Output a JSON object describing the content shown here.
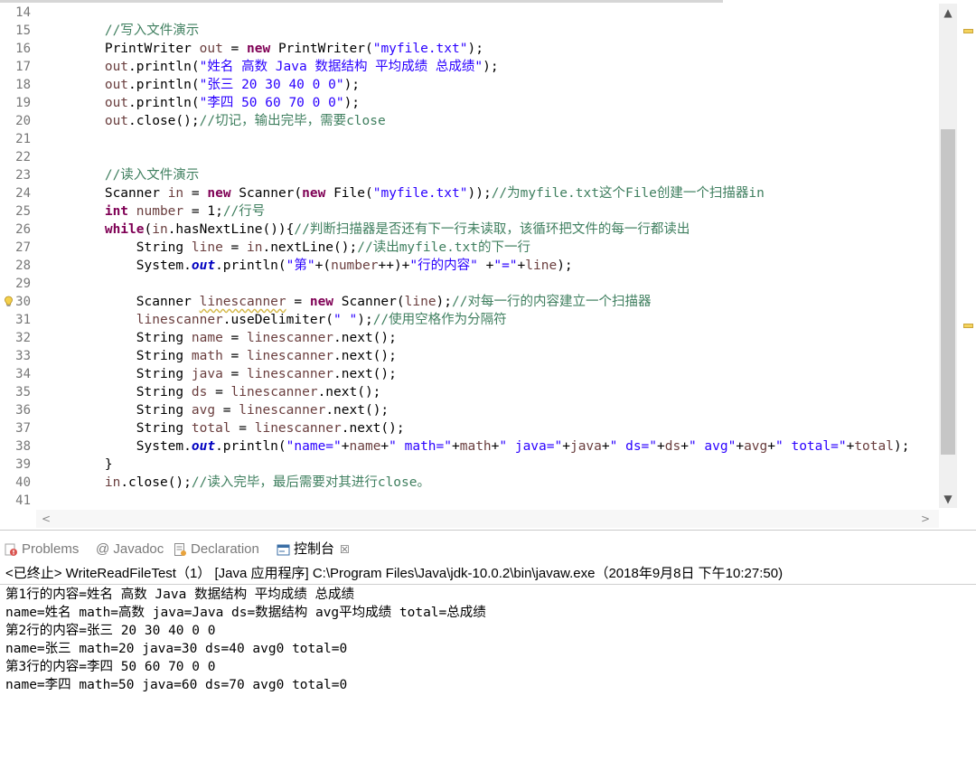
{
  "editor": {
    "line_numbers": [
      "14",
      "15",
      "16",
      "17",
      "18",
      "19",
      "20",
      "21",
      "22",
      "23",
      "24",
      "25",
      "26",
      "27",
      "28",
      "29",
      "30",
      "31",
      "32",
      "33",
      "34",
      "35",
      "36",
      "37",
      "38",
      "39",
      "40",
      "41"
    ],
    "lines": [
      [],
      [
        [
          "c",
          "        "
        ],
        [
          "com",
          "//写入文件演示"
        ]
      ],
      [
        [
          "p",
          "        PrintWriter "
        ],
        [
          "var",
          "out"
        ],
        [
          "p",
          " = "
        ],
        [
          "kw",
          "new"
        ],
        [
          "p",
          " PrintWriter("
        ],
        [
          "str",
          "\"myfile.txt\""
        ],
        [
          "p",
          ");"
        ]
      ],
      [
        [
          "var",
          "        out"
        ],
        [
          "p",
          ".println("
        ],
        [
          "str",
          "\"姓名 高数 Java 数据结构 平均成绩 总成绩\""
        ],
        [
          "p",
          ");"
        ]
      ],
      [
        [
          "var",
          "        out"
        ],
        [
          "p",
          ".println("
        ],
        [
          "str",
          "\"张三 20 30 40 0 0\""
        ],
        [
          "p",
          ");"
        ]
      ],
      [
        [
          "var",
          "        out"
        ],
        [
          "p",
          ".println("
        ],
        [
          "str",
          "\"李四 50 60 70 0 0\""
        ],
        [
          "p",
          ");"
        ]
      ],
      [
        [
          "var",
          "        out"
        ],
        [
          "p",
          ".close();"
        ],
        [
          "com",
          "//切记，输出完毕，需要close"
        ]
      ],
      [],
      [],
      [
        [
          "c",
          "        "
        ],
        [
          "com",
          "//读入文件演示"
        ]
      ],
      [
        [
          "p",
          "        Scanner "
        ],
        [
          "var",
          "in"
        ],
        [
          "p",
          " = "
        ],
        [
          "kw",
          "new"
        ],
        [
          "p",
          " Scanner("
        ],
        [
          "kw",
          "new"
        ],
        [
          "p",
          " File("
        ],
        [
          "str",
          "\"myfile.txt\""
        ],
        [
          "p",
          "));"
        ],
        [
          "com",
          "//为myfile.txt这个File创建一个扫描器in"
        ]
      ],
      [
        [
          "kw",
          "        int"
        ],
        [
          "p",
          " "
        ],
        [
          "var",
          "number"
        ],
        [
          "p",
          " = 1;"
        ],
        [
          "com",
          "//行号"
        ]
      ],
      [
        [
          "kw",
          "        while"
        ],
        [
          "p",
          "("
        ],
        [
          "var",
          "in"
        ],
        [
          "p",
          ".hasNextLine()){"
        ],
        [
          "com",
          "//判断扫描器是否还有下一行未读取，该循环把文件的每一行都读出"
        ]
      ],
      [
        [
          "p",
          "            String "
        ],
        [
          "var",
          "line"
        ],
        [
          "p",
          " = "
        ],
        [
          "var",
          "in"
        ],
        [
          "p",
          ".nextLine();"
        ],
        [
          "com",
          "//读出myfile.txt的下一行"
        ]
      ],
      [
        [
          "p",
          "            System."
        ],
        [
          "fld",
          "out"
        ],
        [
          "p",
          ".println("
        ],
        [
          "str",
          "\"第\""
        ],
        [
          "p",
          "+("
        ],
        [
          "var",
          "number"
        ],
        [
          "p",
          "++)+"
        ],
        [
          "str",
          "\"行的内容\""
        ],
        [
          "p",
          " +"
        ],
        [
          "str",
          "\"=\""
        ],
        [
          "p",
          "+"
        ],
        [
          "var",
          "line"
        ],
        [
          "p",
          ");"
        ]
      ],
      [],
      [
        [
          "p",
          "            Scanner "
        ],
        [
          "warn",
          "linescanner"
        ],
        [
          "p",
          " = "
        ],
        [
          "kw",
          "new"
        ],
        [
          "p",
          " Scanner("
        ],
        [
          "var",
          "line"
        ],
        [
          "p",
          ");"
        ],
        [
          "com",
          "//对每一行的内容建立一个扫描器"
        ]
      ],
      [
        [
          "var",
          "            linescanner"
        ],
        [
          "p",
          ".useDelimiter("
        ],
        [
          "str",
          "\" \""
        ],
        [
          "p",
          ");"
        ],
        [
          "com",
          "//使用空格作为分隔符"
        ]
      ],
      [
        [
          "p",
          "            String "
        ],
        [
          "var",
          "name"
        ],
        [
          "p",
          " = "
        ],
        [
          "var",
          "linescanner"
        ],
        [
          "p",
          ".next();"
        ]
      ],
      [
        [
          "p",
          "            String "
        ],
        [
          "var",
          "math"
        ],
        [
          "p",
          " = "
        ],
        [
          "var",
          "linescanner"
        ],
        [
          "p",
          ".next();"
        ]
      ],
      [
        [
          "p",
          "            String "
        ],
        [
          "var",
          "java"
        ],
        [
          "p",
          " = "
        ],
        [
          "var",
          "linescanner"
        ],
        [
          "p",
          ".next();"
        ]
      ],
      [
        [
          "p",
          "            String "
        ],
        [
          "var",
          "ds"
        ],
        [
          "p",
          " = "
        ],
        [
          "var",
          "linescanner"
        ],
        [
          "p",
          ".next();"
        ]
      ],
      [
        [
          "p",
          "            String "
        ],
        [
          "var",
          "avg"
        ],
        [
          "p",
          " = "
        ],
        [
          "var",
          "linescanner"
        ],
        [
          "p",
          ".next();"
        ]
      ],
      [
        [
          "p",
          "            String "
        ],
        [
          "var",
          "total"
        ],
        [
          "p",
          " = "
        ],
        [
          "var",
          "linescanner"
        ],
        [
          "p",
          ".next();"
        ]
      ],
      [
        [
          "p",
          "            System."
        ],
        [
          "fld",
          "out"
        ],
        [
          "p",
          ".println("
        ],
        [
          "str",
          "\"name=\""
        ],
        [
          "p",
          "+"
        ],
        [
          "var",
          "name"
        ],
        [
          "p",
          "+"
        ],
        [
          "str",
          "\" math=\""
        ],
        [
          "p",
          "+"
        ],
        [
          "var",
          "math"
        ],
        [
          "p",
          "+"
        ],
        [
          "str",
          "\" java=\""
        ],
        [
          "p",
          "+"
        ],
        [
          "var",
          "java"
        ],
        [
          "p",
          "+"
        ],
        [
          "str",
          "\" ds=\""
        ],
        [
          "p",
          "+"
        ],
        [
          "var",
          "ds"
        ],
        [
          "p",
          "+"
        ],
        [
          "str",
          "\" avg\""
        ],
        [
          "p",
          "+"
        ],
        [
          "var",
          "avg"
        ],
        [
          "p",
          "+"
        ],
        [
          "str",
          "\" total=\""
        ],
        [
          "p",
          "+"
        ],
        [
          "var",
          "total"
        ],
        [
          "p",
          ");"
        ]
      ],
      [
        [
          "p",
          "        }"
        ]
      ],
      [
        [
          "var",
          "        in"
        ],
        [
          "p",
          ".close();"
        ],
        [
          "com",
          "//读入完毕，最后需要对其进行close。"
        ]
      ],
      []
    ],
    "warning_icon": "warning-lightbulb-icon",
    "scroll_up_icon": "▲",
    "scroll_down_icon": "▼",
    "scroll_left_icon": "<",
    "scroll_right_icon": ">"
  },
  "views": {
    "tabs": [
      {
        "label": "Problems",
        "icon": "problems-icon",
        "active": false
      },
      {
        "label": "@ Javadoc",
        "icon": "javadoc-icon",
        "active": false
      },
      {
        "label": "Declaration",
        "icon": "declaration-icon",
        "active": false
      },
      {
        "label": "控制台",
        "icon": "console-icon",
        "active": true
      }
    ],
    "close_glyph": "☒"
  },
  "console": {
    "header": "<已终止> WriteReadFileTest（1） [Java 应用程序] C:\\Program Files\\Java\\jdk-10.0.2\\bin\\javaw.exe（2018年9月8日 下午10:27:50)",
    "output": [
      "第1行的内容=姓名 高数 Java 数据结构 平均成绩 总成绩",
      "name=姓名 math=高数 java=Java ds=数据结构 avg平均成绩 total=总成绩",
      "第2行的内容=张三 20 30 40 0 0",
      "name=张三 math=20 java=30 ds=40 avg0 total=0",
      "第3行的内容=李四 50 60 70 0 0",
      "name=李四 math=50 java=60 ds=70 avg0 total=0"
    ]
  },
  "colors": {
    "keyword": "#7f0055",
    "string": "#2a00ff",
    "comment": "#3f7f5f",
    "local_variable": "#6a3e3e",
    "static_field": "#0000c0"
  }
}
